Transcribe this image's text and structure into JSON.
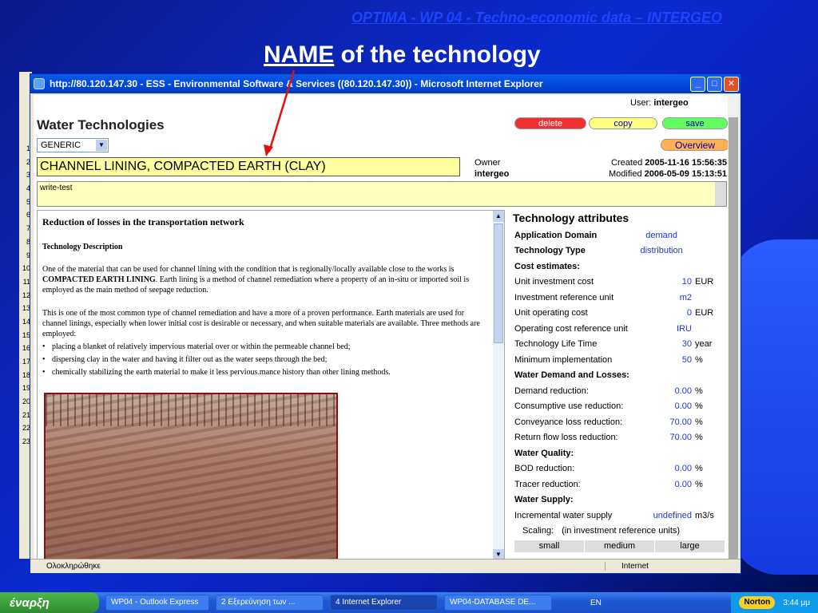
{
  "slide": {
    "header": "OPTIMA - WP 04 - Techno-economic data – INTERGEO",
    "title_underlined": "NAME",
    "title_rest": " of the technology"
  },
  "line_numbers": [
    "1",
    "2",
    "3",
    "4",
    "5",
    "6",
    "7",
    "8",
    "9",
    "10",
    "11",
    "12",
    "13",
    "14",
    "15",
    "16",
    "17",
    "18",
    "19",
    "20",
    "21",
    "22",
    "23"
  ],
  "window": {
    "title": "http://80.120.147.30 - ESS - Environmental Software & Services ((80.120.147.30)) - Microsoft Internet Explorer",
    "minimize": "_",
    "maximize": "□",
    "close": "✕"
  },
  "app": {
    "user_prefix": "User: ",
    "user_name": "intergeo",
    "title": "Water Technologies",
    "buttons": {
      "delete": "delete",
      "copy": "copy",
      "save": "save",
      "overview": "Overview"
    },
    "category_select": "GENERIC",
    "tech_name": "CHANNEL LINING, COMPACTED EARTH (CLAY)",
    "owner_label": "Owner",
    "owner_value": "intergeo",
    "created_label": "Created ",
    "created_value": "2005-11-16 15:56:35",
    "modified_label": "Modified ",
    "modified_value": "2006-05-09 15:13:51",
    "notes": "write-test"
  },
  "description": {
    "heading": "Reduction of losses in the transportation network",
    "subheading": "Technology Description",
    "para1_a": "One of the material that can be used for channel lining with the condition that is regionally/locally available close to the works is ",
    "para1_bold": "COMPACTED EARTH LINING",
    "para1_b": ". Earth lining is a method of channel remediation where a property of an in-situ or imported soil is employed as the main method of seepage reduction.",
    "para2": "This is one of the most common type of channel remediation and have a more of a proven performance. Earth materials are used for channel linings, especially when lower initial cost is desirable or necessary, and when suitable materials are available. Three methods are employed:",
    "bullets": [
      "placing a blanket of relatively impervious material over or within the permeable channel bed;",
      "dispersing clay in the water and having it filter out as the water seeps through the bed;",
      "chemically stabilizing the earth material to make it less pervious.mance history than other lining methods."
    ]
  },
  "attributes": {
    "title": "Technology attributes",
    "rows": [
      {
        "label": "Application Domain",
        "value": "demand",
        "unit": "",
        "kind": "bold"
      },
      {
        "label": "Technology Type",
        "value": "distribution",
        "unit": "",
        "kind": "bold"
      },
      {
        "label": "Cost estimates:",
        "value": "",
        "unit": "",
        "kind": "section"
      },
      {
        "label": "Unit investment cost",
        "value": "10",
        "unit": "EUR",
        "kind": ""
      },
      {
        "label": "Investment reference unit",
        "value": "m2",
        "unit": "",
        "kind": ""
      },
      {
        "label": "Unit operating cost",
        "value": "0",
        "unit": "EUR",
        "kind": ""
      },
      {
        "label": "Operating cost reference unit",
        "value": "IRU",
        "unit": "",
        "kind": ""
      },
      {
        "label": "Technology Life Time",
        "value": "30",
        "unit": "year",
        "kind": ""
      },
      {
        "label": "Minimum implementation",
        "value": "50",
        "unit": "%",
        "kind": ""
      },
      {
        "label": "Water Demand and Losses:",
        "value": "",
        "unit": "",
        "kind": "section"
      },
      {
        "label": "Demand reduction:",
        "value": "0.00",
        "unit": "%",
        "kind": ""
      },
      {
        "label": "Consumptive use reduction:",
        "value": "0.00",
        "unit": "%",
        "kind": ""
      },
      {
        "label": "Conveyance loss reduction:",
        "value": "70.00",
        "unit": "%",
        "kind": ""
      },
      {
        "label": "Return flow loss reduction:",
        "value": "70.00",
        "unit": "%",
        "kind": ""
      },
      {
        "label": "Water Quality:",
        "value": "",
        "unit": "",
        "kind": "section"
      },
      {
        "label": "BOD reduction:",
        "value": "0.00",
        "unit": "%",
        "kind": ""
      },
      {
        "label": "Tracer reduction:",
        "value": "0.00",
        "unit": "%",
        "kind": ""
      },
      {
        "label": "Water Supply:",
        "value": "",
        "unit": "",
        "kind": "section"
      },
      {
        "label": "Incremental water supply",
        "value": "undefined",
        "unit": "m3/s",
        "kind": ""
      }
    ],
    "scaling_label": "Scaling:",
    "scaling_note": "(in investment reference units)",
    "scale_columns": [
      "small",
      "medium",
      "large"
    ]
  },
  "status": {
    "left": "Ολοκληρώθηκε",
    "zone": "Internet"
  },
  "taskbar": {
    "start": "έναρξη",
    "tasks": [
      "WP04 - Outlook Express",
      "2 Εξερεύνηση των ...",
      "4 Internet Explorer",
      "WP04-DATABASE DE..."
    ],
    "lang": "EN",
    "norton": "Norton",
    "clock": "3:44 μμ"
  }
}
